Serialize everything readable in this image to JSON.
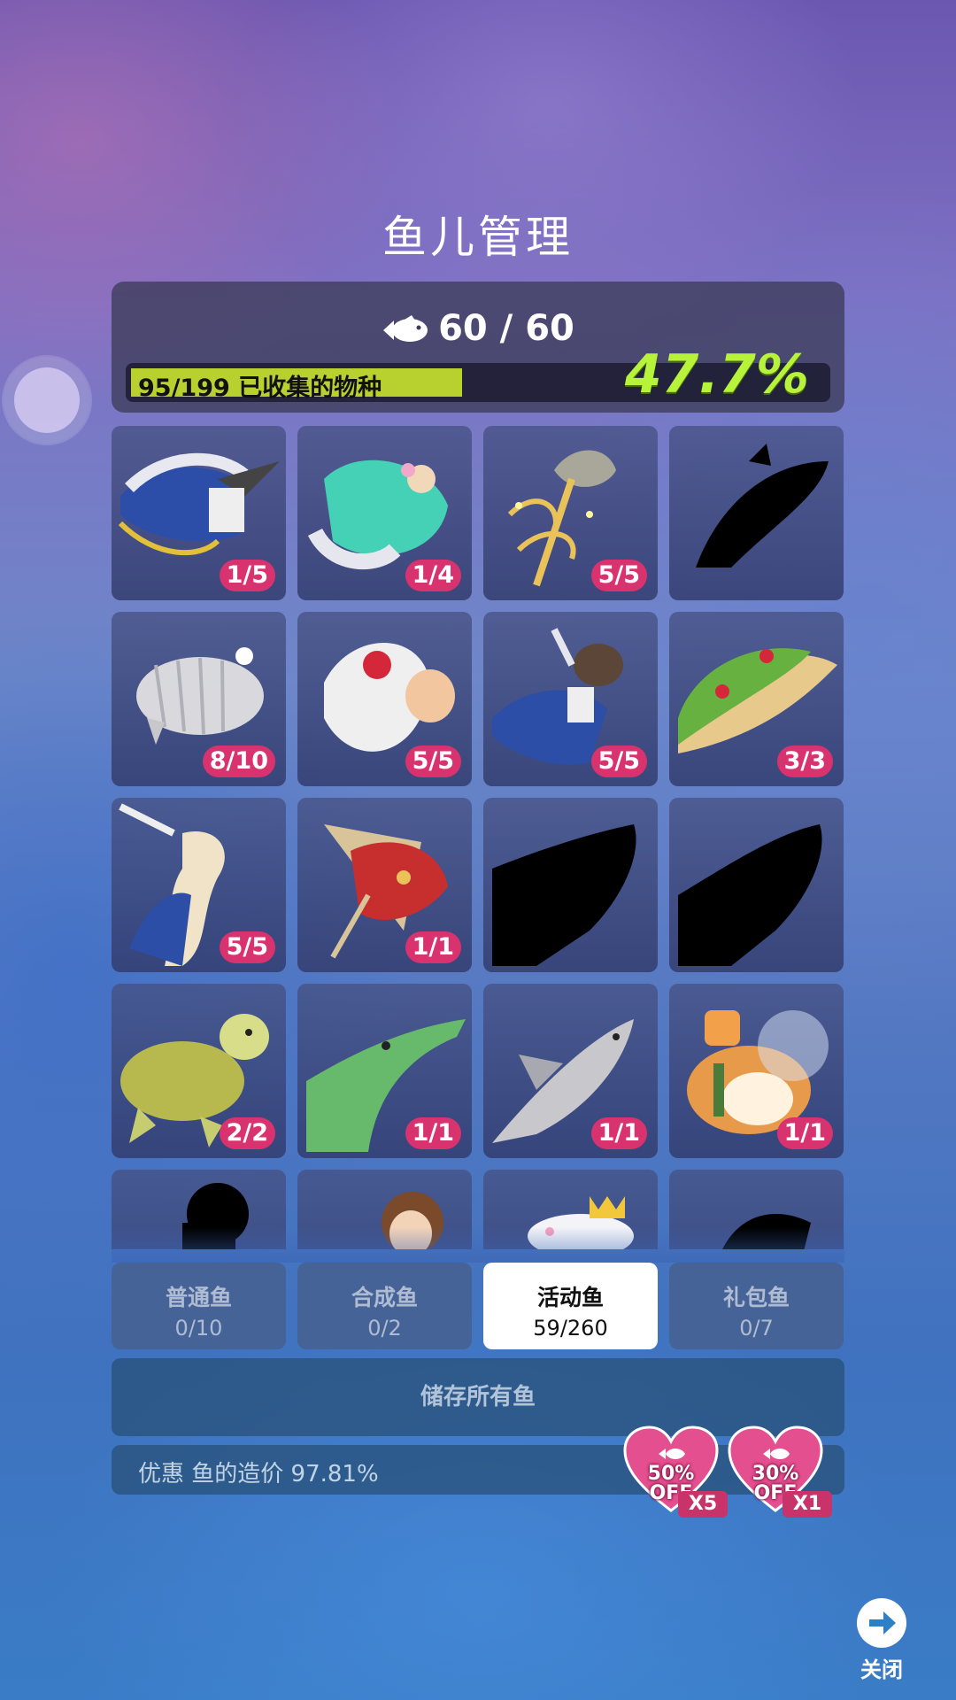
{
  "title": "鱼儿管理",
  "summary": {
    "fish_count": "60 / 60",
    "collected_label": "95/199 已收集的物种",
    "collected_fraction": 0.477,
    "percent_text": "47.7%"
  },
  "grid": [
    {
      "name": "marlin-prince",
      "badge": "1/5",
      "locked": false
    },
    {
      "name": "mint-dress-fish",
      "badge": "1/4",
      "locked": false
    },
    {
      "name": "golden-jellyfish",
      "badge": "5/5",
      "locked": false
    },
    {
      "name": "axolotl",
      "badge": "",
      "locked": true
    },
    {
      "name": "isopod",
      "badge": "8/10",
      "locked": false
    },
    {
      "name": "bride-fish",
      "badge": "5/5",
      "locked": false
    },
    {
      "name": "otter-prince",
      "badge": "5/5",
      "locked": false
    },
    {
      "name": "rose-dolphin",
      "badge": "3/3",
      "locked": false
    },
    {
      "name": "seahorse-prince",
      "badge": "5/5",
      "locked": false
    },
    {
      "name": "red-ray",
      "badge": "1/1",
      "locked": false
    },
    {
      "name": "crocodile-fish",
      "badge": "",
      "locked": true
    },
    {
      "name": "whale",
      "badge": "",
      "locked": true
    },
    {
      "name": "sea-turtle",
      "badge": "2/2",
      "locked": false
    },
    {
      "name": "gharial",
      "badge": "1/1",
      "locked": false
    },
    {
      "name": "shark",
      "badge": "1/1",
      "locked": false
    },
    {
      "name": "astronaut-corgi",
      "badge": "1/1",
      "locked": false
    },
    {
      "name": "unknown-1",
      "badge": "",
      "locked": true
    },
    {
      "name": "girl",
      "badge": "",
      "locked": false
    },
    {
      "name": "crowned-axolotl",
      "badge": "",
      "locked": false
    },
    {
      "name": "unknown-2",
      "badge": "",
      "locked": true
    }
  ],
  "tabs": [
    {
      "label": "普通鱼",
      "count": "0/10",
      "active": false
    },
    {
      "label": "合成鱼",
      "count": "0/2",
      "active": false
    },
    {
      "label": "活动鱼",
      "count": "59/260",
      "active": true
    },
    {
      "label": "礼包鱼",
      "count": "0/7",
      "active": false
    }
  ],
  "store_all_label": "储存所有鱼",
  "discount_text": "优惠 鱼的造价 97.81%",
  "coupons": [
    {
      "percent": "50%",
      "off": "OFF",
      "multiplier": "X5"
    },
    {
      "percent": "30%",
      "off": "OFF",
      "multiplier": "X1"
    }
  ],
  "close_label": "关闭",
  "colors": {
    "badge": "#d8336f",
    "progress": "#b8d12e",
    "percent": "#b6f33a",
    "coupon_heart": "#e34f8f"
  }
}
